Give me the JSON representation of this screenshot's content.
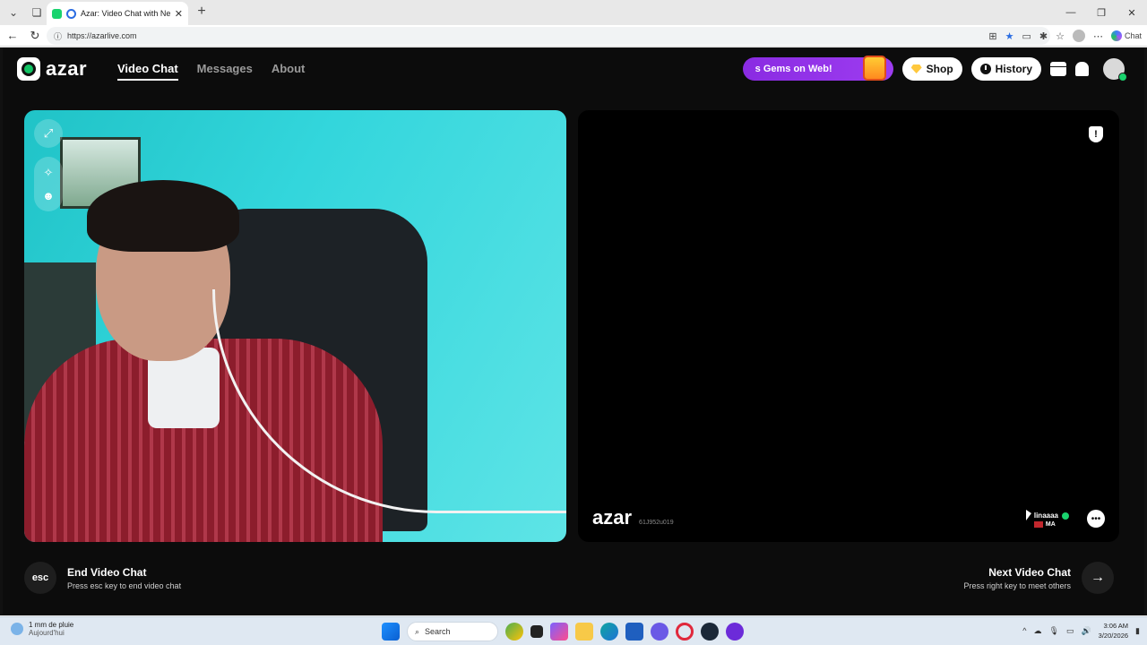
{
  "browser": {
    "tab_title": "Azar: Video Chat with New Pe",
    "url": "https://azarlive.com",
    "copilot_label": "Chat",
    "close_tab": "✕",
    "new_tab": "+",
    "win_min": "—",
    "win_max": "❐",
    "win_close": "✕"
  },
  "header": {
    "logo": "azar",
    "nav": [
      "Video Chat",
      "Messages",
      "About"
    ],
    "gems_promo": "s Gems on Web!",
    "shop": "Shop",
    "history": "History"
  },
  "video_right": {
    "watermark": "azar",
    "session_id": "61J952u019",
    "peer_name": "linaaaa",
    "peer_country": "MA"
  },
  "controls": {
    "esc_key": "esc",
    "end_title": "End Video Chat",
    "end_sub": "Press esc key to end video chat",
    "next_title": "Next Video Chat",
    "next_sub": "Press right key to meet others",
    "next_arrow": "→"
  },
  "taskbar": {
    "weather_line1": "1 mm de pluie",
    "weather_line2": "Aujourd'hui",
    "search": "Search",
    "time": "3:06 AM",
    "date": "3/20/2026"
  },
  "colors": {
    "accent_green": "#19d36e",
    "gems_purple": "#8a2be2",
    "page_bg": "#0c0c0c"
  }
}
